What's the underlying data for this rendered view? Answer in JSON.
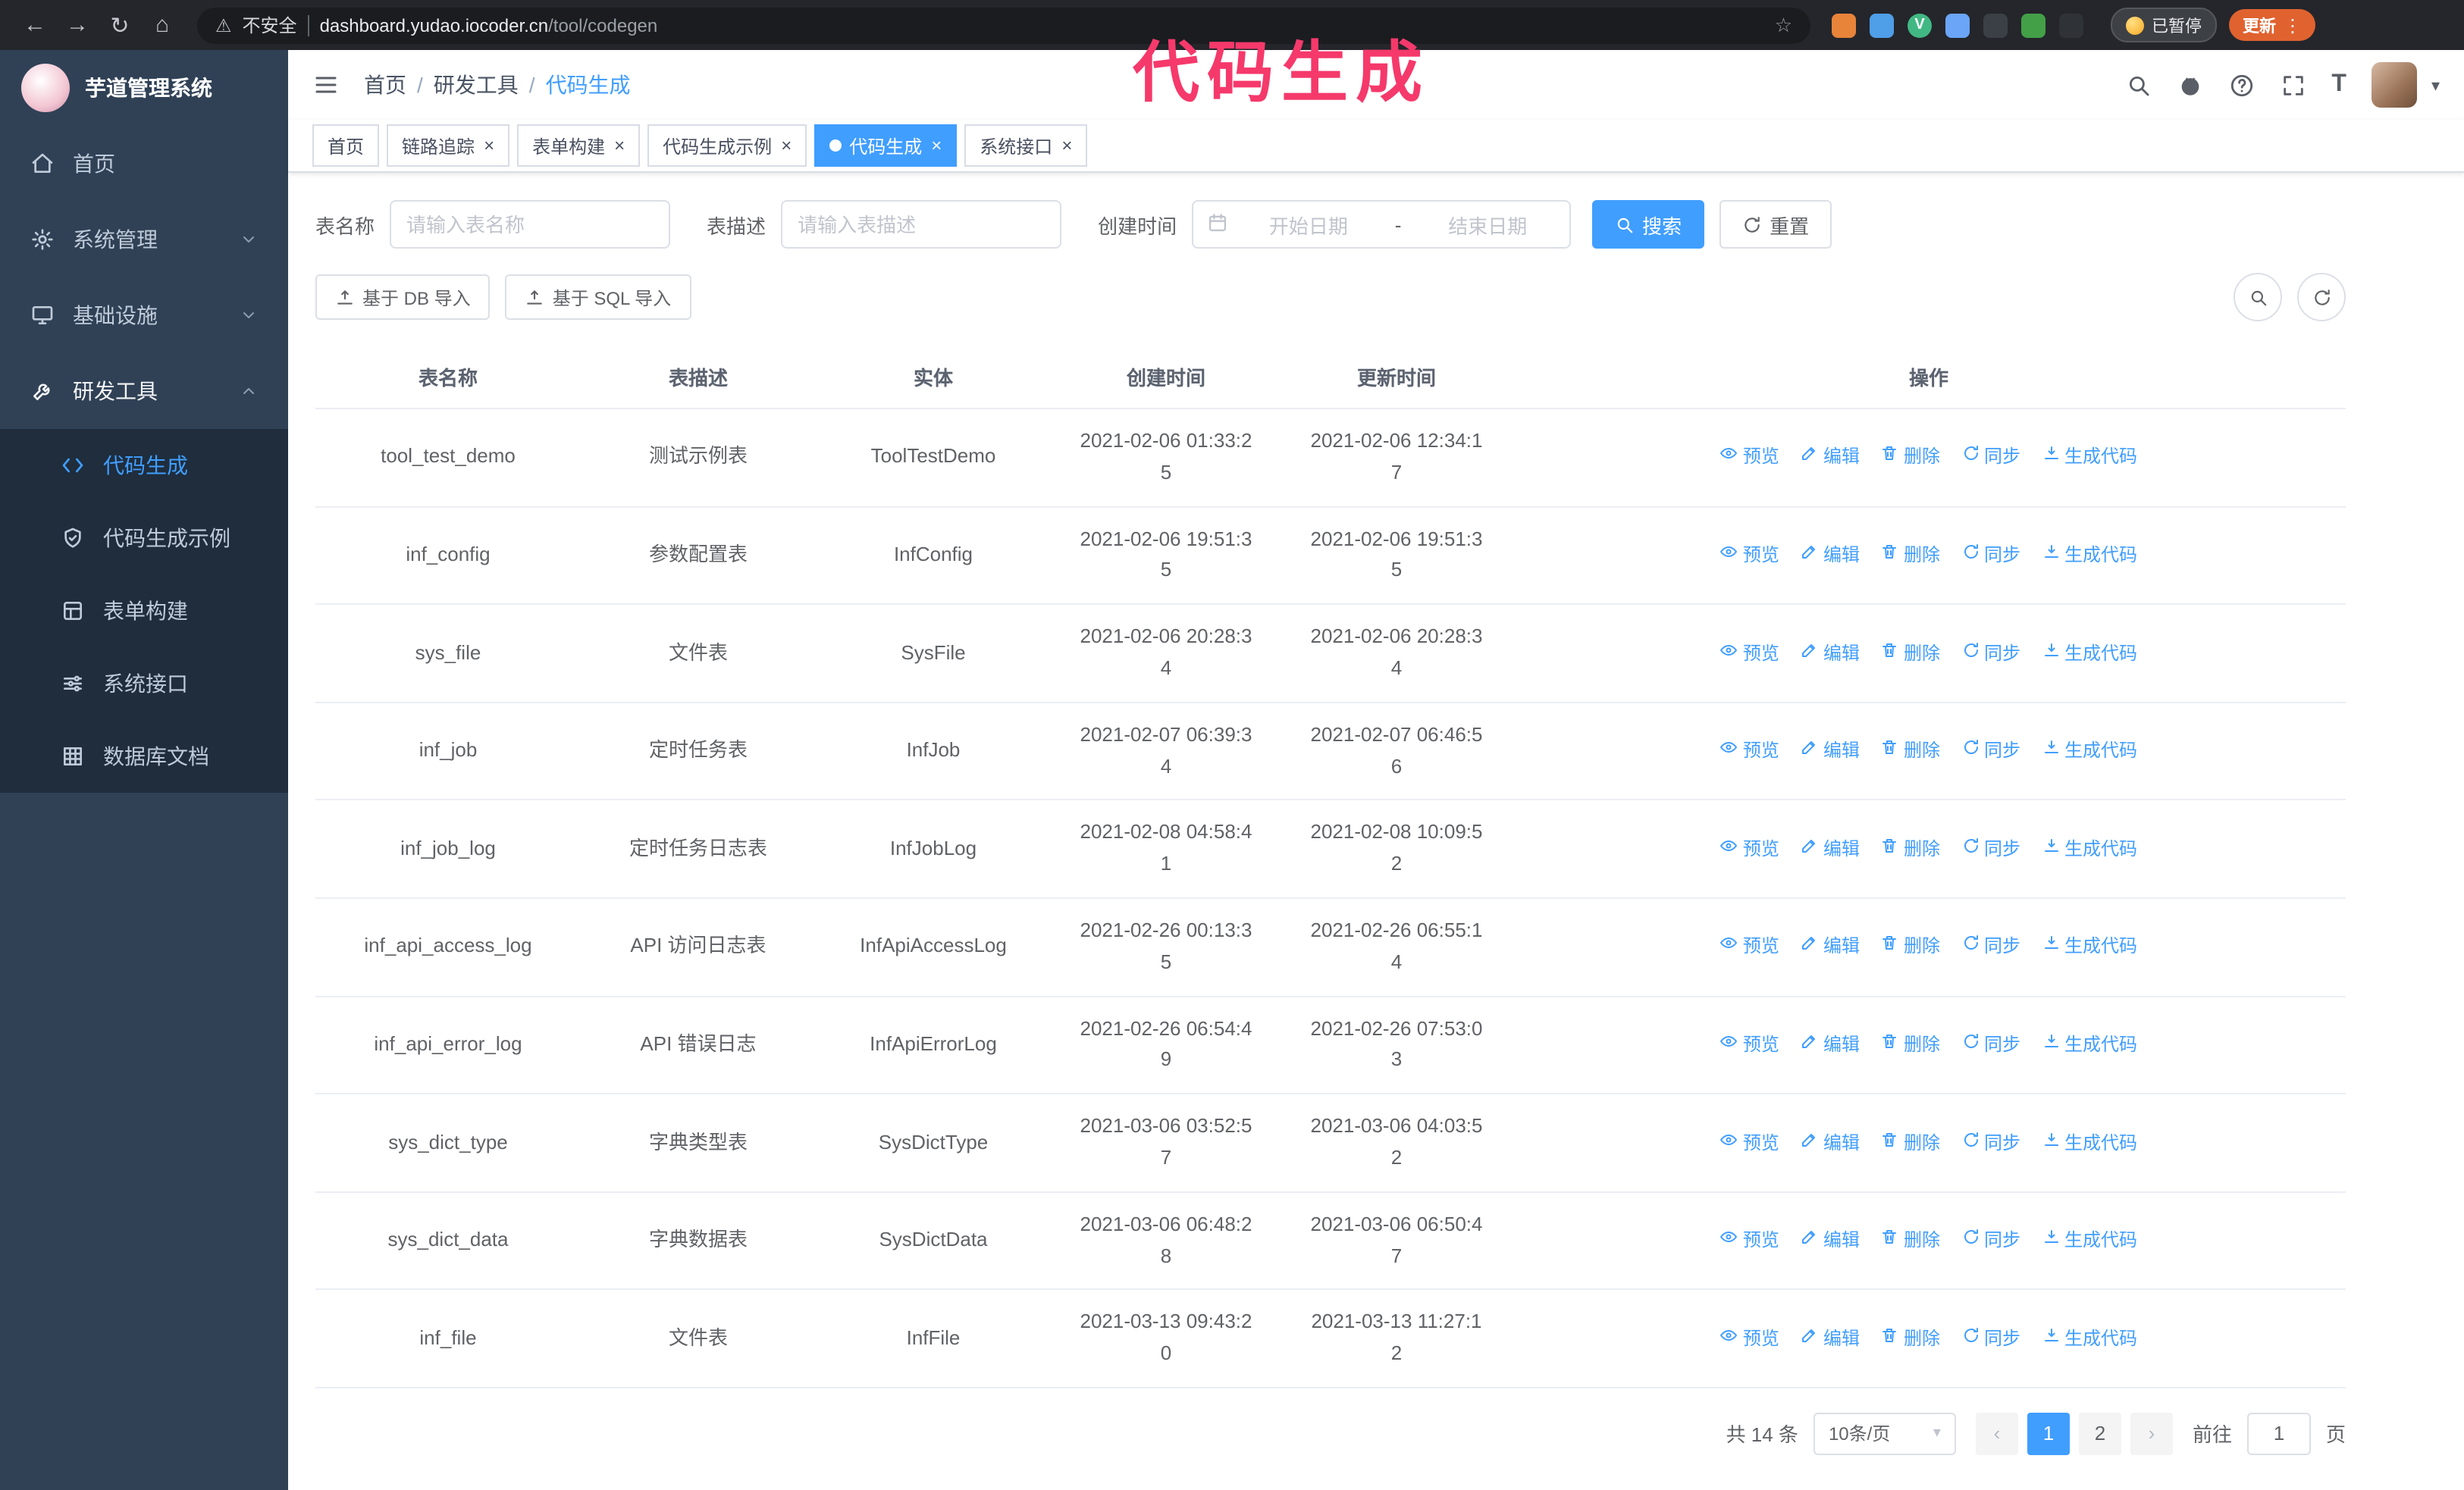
{
  "annotation": "代码生成",
  "glyphs": {
    "back": "←",
    "forward": "→",
    "reload": "↻",
    "home": "⌂",
    "star": "☆",
    "kebab": "⋮",
    "caret": "▾",
    "close": "×",
    "warning": "⚠",
    "slash": "/",
    "font_size": "T",
    "prev": "‹",
    "next": "›"
  },
  "browser": {
    "security_label": "不安全",
    "url_host": "dashboard.yudao.iocoder.cn",
    "url_path": "/tool/codegen",
    "paused_badge": "已暂停",
    "update_button": "更新",
    "extensions": [
      {
        "name": "extension-orange",
        "color": "#e8833a",
        "letter": ""
      },
      {
        "name": "extension-blue",
        "color": "#4f9ee8",
        "letter": ""
      },
      {
        "name": "extension-vue-devtools",
        "color": "#41b883",
        "letter": "V"
      },
      {
        "name": "extension-people",
        "color": "#6aa5f8",
        "letter": ""
      },
      {
        "name": "extension-dark",
        "color": "#3b4046",
        "letter": ""
      },
      {
        "name": "extension-green",
        "color": "#43a047",
        "letter": ""
      },
      {
        "name": "extension-puzzle",
        "color": "#2f3337",
        "letter": ""
      }
    ]
  },
  "sidebar": {
    "logo_title": "芋道管理系统",
    "menu": [
      {
        "label": "首页",
        "icon": "home-icon"
      },
      {
        "label": "系统管理",
        "icon": "gear-icon",
        "chevron": "down"
      },
      {
        "label": "基础设施",
        "icon": "infra-icon",
        "chevron": "down"
      },
      {
        "label": "研发工具",
        "icon": "tools-icon",
        "chevron": "up",
        "expanded": true
      }
    ],
    "submenu": [
      {
        "label": "代码生成",
        "icon": "code-icon",
        "active": true
      },
      {
        "label": "代码生成示例",
        "icon": "shield-icon"
      },
      {
        "label": "表单构建",
        "icon": "form-icon"
      },
      {
        "label": "系统接口",
        "icon": "api-icon"
      },
      {
        "label": "数据库文档",
        "icon": "grid-icon"
      }
    ]
  },
  "header": {
    "breadcrumb": [
      "首页",
      "研发工具",
      "代码生成"
    ]
  },
  "tabs": [
    {
      "label": "首页",
      "closable": false,
      "active": false
    },
    {
      "label": "链路追踪",
      "closable": true,
      "active": false
    },
    {
      "label": "表单构建",
      "closable": true,
      "active": false
    },
    {
      "label": "代码生成示例",
      "closable": true,
      "active": false
    },
    {
      "label": "代码生成",
      "closable": true,
      "active": true
    },
    {
      "label": "系统接口",
      "closable": true,
      "active": false
    }
  ],
  "filters": {
    "table_name_label": "表名称",
    "table_name_placeholder": "请输入表名称",
    "table_desc_label": "表描述",
    "table_desc_placeholder": "请输入表描述",
    "create_time_label": "创建时间",
    "date_start_placeholder": "开始日期",
    "date_separator": "-",
    "date_end_placeholder": "结束日期",
    "search_button": "搜索",
    "reset_button": "重置"
  },
  "toolbar": {
    "import_db": "基于 DB 导入",
    "import_sql": "基于 SQL 导入"
  },
  "table": {
    "columns": [
      "表名称",
      "表描述",
      "实体",
      "创建时间",
      "更新时间",
      "操作"
    ],
    "actions": [
      "预览",
      "编辑",
      "删除",
      "同步",
      "生成代码"
    ],
    "rows": [
      {
        "name": "tool_test_demo",
        "desc": "测试示例表",
        "entity": "ToolTestDemo",
        "created": "2021-02-06 01:33:25",
        "updated": "2021-02-06 12:34:17"
      },
      {
        "name": "inf_config",
        "desc": "参数配置表",
        "entity": "InfConfig",
        "created": "2021-02-06 19:51:35",
        "updated": "2021-02-06 19:51:35"
      },
      {
        "name": "sys_file",
        "desc": "文件表",
        "entity": "SysFile",
        "created": "2021-02-06 20:28:34",
        "updated": "2021-02-06 20:28:34"
      },
      {
        "name": "inf_job",
        "desc": "定时任务表",
        "entity": "InfJob",
        "created": "2021-02-07 06:39:34",
        "updated": "2021-02-07 06:46:56"
      },
      {
        "name": "inf_job_log",
        "desc": "定时任务日志表",
        "entity": "InfJobLog",
        "created": "2021-02-08 04:58:41",
        "updated": "2021-02-08 10:09:52"
      },
      {
        "name": "inf_api_access_log",
        "desc": "API 访问日志表",
        "entity": "InfApiAccessLog",
        "created": "2021-02-26 00:13:35",
        "updated": "2021-02-26 06:55:14"
      },
      {
        "name": "inf_api_error_log",
        "desc": "API 错误日志",
        "entity": "InfApiErrorLog",
        "created": "2021-02-26 06:54:49",
        "updated": "2021-02-26 07:53:03"
      },
      {
        "name": "sys_dict_type",
        "desc": "字典类型表",
        "entity": "SysDictType",
        "created": "2021-03-06 03:52:57",
        "updated": "2021-03-06 04:03:52"
      },
      {
        "name": "sys_dict_data",
        "desc": "字典数据表",
        "entity": "SysDictData",
        "created": "2021-03-06 06:48:28",
        "updated": "2021-03-06 06:50:47"
      },
      {
        "name": "inf_file",
        "desc": "文件表",
        "entity": "InfFile",
        "created": "2021-03-13 09:43:20",
        "updated": "2021-03-13 11:27:12"
      }
    ]
  },
  "pagination": {
    "total": "共 14 条",
    "page_size": "10条/页",
    "pages": [
      "1",
      "2"
    ],
    "active_page": "1",
    "goto_label": "前往",
    "goto_value": "1",
    "page_unit": "页"
  }
}
